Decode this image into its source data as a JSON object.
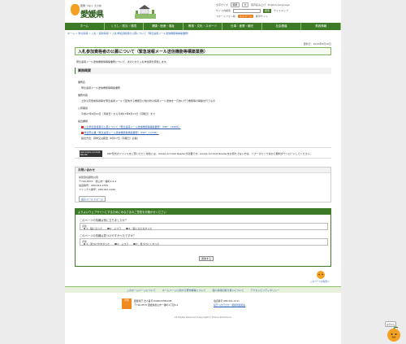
{
  "header": {
    "logo_catch": "愛顔 つなぐ えひめ",
    "logo_name": "愛媛県",
    "tools_row1": [
      "文字サイズ",
      "標準",
      "大",
      "音声読み上げ",
      "English Language"
    ],
    "tools_row2_label": "サイト内検索",
    "search_placeholder": "",
    "search_button": "検索",
    "tools_row2_right": "サイトマップ",
    "tools_row3": [
      "スマートフォン版",
      "マイページ",
      "携帯サイト"
    ]
  },
  "gnav": [
    "ホーム",
    "くらし・防災・環境",
    "健康・医療・福祉",
    "教育・文化・スポーツ",
    "仕事・産業・観光",
    "社会基盤",
    "県政情報"
  ],
  "breadcrumb": "ホーム > 防災情報 > 入札・契約情報 > 入札参加資格者の公募について（緊急速報メール送信機能等構築業務）",
  "updated": "更新日：2015年8月10日",
  "title": "入札参加資格者の公募について（緊急速報メール送信機能等構築業務）",
  "lead": "緊急速報メール送信機能等構築業務について、次のとおり入札参加者を募集します。",
  "overview": {
    "heading": "業務概要",
    "items": [
      "業務名",
      "緊急速報メール送信機能等構築業務",
      "業務内容",
      "土砂災害警戒情報等を緊急速報メールで配信する機能及び他の防災情報メール送信を一元的に行う機能等の構築を行うもの",
      "公募期間",
      "平成27年8月10日（月曜日）から平成27年8月17日（月曜日）まで",
      "提出書類",
      "入札参加資格者の公募について（緊急速報メール送信機能等構築業務）（PDF：189KB）",
      "参加申込書（緊急速報メール送信機能等構築業務）（PDF：127KB）",
      "提出方法：持参又は郵送（8月17日（月曜日）必着）"
    ]
  },
  "reader": {
    "badge": "Get Adobe Acrobat Reader",
    "text": "PDF形式のファイルをご覧いただく場合には、Adobe Acrobat Readerが必要です。Adobe Acrobat Readerをお持ちでない方は、バナーのリンク先から無料ダウンロードしてください。"
  },
  "contact": {
    "heading": "お問い合わせ",
    "lines": [
      "県民環境部防災局",
      "〒790-8570　松山市一番町4-4-2",
      "電話番号：089-912-2335",
      "ファックス番号：089-941-2160"
    ],
    "form_button": "電子メールフォーム"
  },
  "survey": {
    "heading": "よりよいウェブサイトにするためにみなさまのご意見をお聞かせください",
    "q1": "このページの情報は役に立ちましたか？",
    "q2": "このページの情報は見つけやすかったですか？",
    "eval_label": "評価",
    "q1_options": [
      "1：役に立った",
      "2：ふつう",
      "3：役に立たなかった"
    ],
    "q2_options": [
      "1：見つけやすかった",
      "2：ふつう",
      "3：見つけにくかった"
    ],
    "submit": "送信する"
  },
  "pagetop": "このページの先頭へ",
  "footer_links": [
    "このホームページについて",
    "ホームページに関する著作権等について",
    "個人情報の取り扱いについて",
    "アクセシビリティポリシー"
  ],
  "footer": {
    "seal": "県章",
    "left": [
      "愛媛県庁 法人番号1000020380008",
      "〒790-8570 愛媛県松山市一番町4丁目4-2"
    ],
    "right": [
      "電話番号 089-941-2111",
      "県庁への行き方・組織別連絡先"
    ]
  },
  "copyright": "All Rights Reserved Copyright(c) Ehime Prefecture",
  "mascot_text": "みきゃん"
}
